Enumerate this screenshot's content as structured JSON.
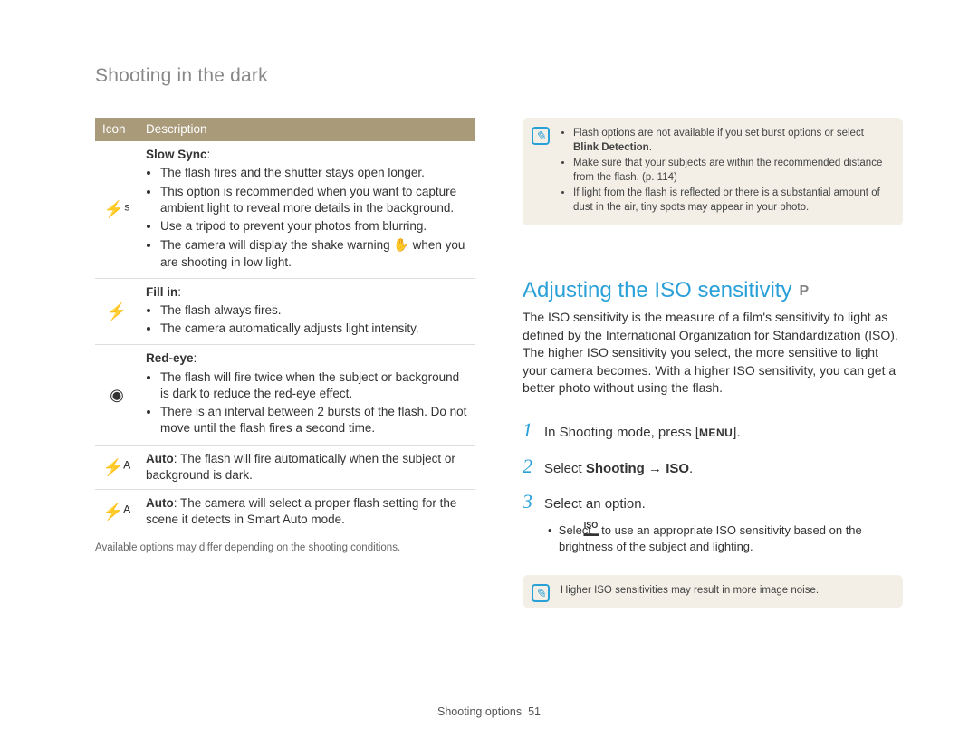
{
  "page_title": "Shooting in the dark",
  "table_headers": {
    "icon": "Icon",
    "desc": "Description"
  },
  "rows": {
    "slow_sync": {
      "icon": "⚡ˢ",
      "title": "Slow Sync",
      "b1": "The flash fires and the shutter stays open longer.",
      "b2": "This option is recommended when you want to capture ambient light to reveal more details in the background.",
      "b3": "Use a tripod to prevent your photos from blurring.",
      "b4a": "The camera will display the shake warning ",
      "b4b": " when you are shooting in low light."
    },
    "fill_in": {
      "icon": "⚡",
      "title": "Fill in",
      "b1": "The flash always fires.",
      "b2": "The camera automatically adjusts light intensity."
    },
    "red_eye": {
      "icon": "◉",
      "title": "Red-eye",
      "b1": "The flash will fire twice when the subject or background is dark to reduce the red-eye effect.",
      "b2": "There is an interval between 2 bursts of the flash. Do not move until the flash fires a second time."
    },
    "auto1": {
      "icon": "⚡ᴬ",
      "label": "Auto",
      "text": ": The flash will fire automatically when the subject or background is dark."
    },
    "auto2": {
      "icon": "⚡ᴬ",
      "label": "Auto",
      "text": ": The camera will select a proper flash setting for the scene it detects in Smart Auto mode."
    }
  },
  "footnote": "Available options may differ depending on the shooting conditions.",
  "note1": {
    "b1a": "Flash options are not available if you set burst options or select ",
    "b1b": "Blink Detection",
    "b1c": ".",
    "b2": "Make sure that your subjects are within the recommended distance from the flash. (p. 114)",
    "b3": "If light from the flash is reflected or there is a substantial amount of dust in the air, tiny spots may appear in your photo."
  },
  "section_heading": "Adjusting the ISO sensitivity",
  "section_mode": "P",
  "body_para": "The ISO sensitivity is the measure of a film's sensitivity to light as defined by the International Organization for Standardization (ISO). The higher ISO sensitivity you select, the more sensitive to light your camera becomes. With a higher ISO sensitivity, you can get a better photo without using the flash.",
  "steps": {
    "s1a": "In Shooting mode, press [",
    "s1b": "MENU",
    "s1c": "].",
    "s2a": "Select ",
    "s2b": "Shooting",
    "s2c": " → ",
    "s2d": "ISO",
    "s2e": ".",
    "s3": "Select an option.",
    "s3suba": "Select ",
    "s3subb": " to use an appropriate ISO sensitivity based on the brightness of the subject and lighting."
  },
  "note2": "Higher ISO sensitivities may result in more image noise.",
  "footer": {
    "label": "Shooting options",
    "page": "51"
  }
}
